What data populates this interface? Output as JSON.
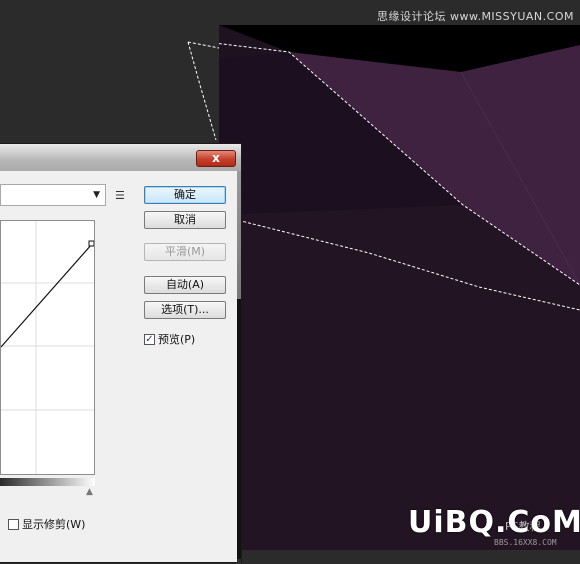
{
  "watermark": {
    "top": "思缘设计论坛 www.MISSYUAN.COM",
    "logo": "UiBQ.CoM",
    "ps": "PS教程",
    "sub": "BBS.16XX8.COM"
  },
  "dialog": {
    "close_glyph": "x",
    "buttons": {
      "ok": "确定",
      "cancel": "取消",
      "smooth": "平滑(M)",
      "auto": "自动(A)",
      "options": "选项(T)..."
    },
    "preview": {
      "label": "预览(P)",
      "checked": true,
      "mark": "✓"
    },
    "show_clipping": {
      "label": "显示修剪(W)",
      "checked": false
    },
    "preset_arrow": "▼",
    "preset_menu_icon": "☰",
    "white_point_glyph": "▲"
  },
  "colors": {
    "canvas_bg": "#2b2b2b",
    "doc_bg": "#1f1220",
    "shard_purple": "#3e2240",
    "dialog_bg": "#f0f0f0",
    "close_red": "#c4402c"
  }
}
